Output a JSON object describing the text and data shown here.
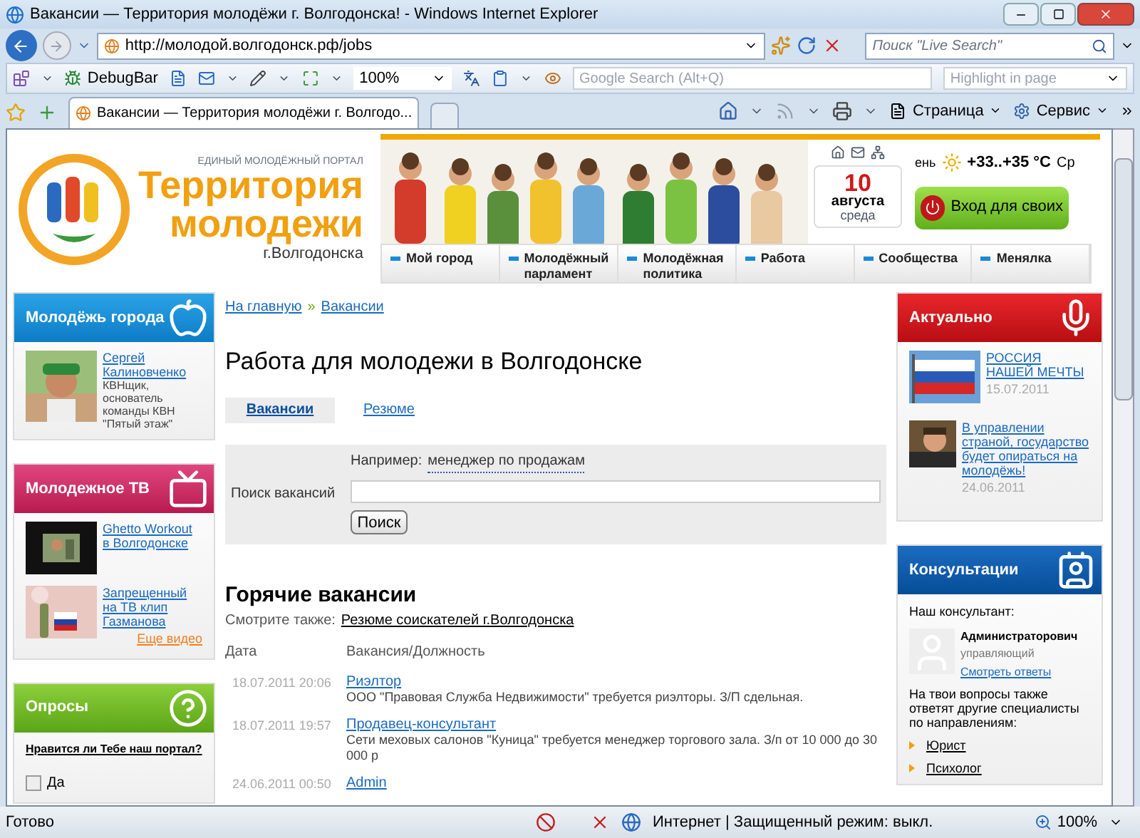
{
  "window": {
    "title": "Вакансии — Территория молодёжи г. Волгодонска! - Windows Internet Explorer"
  },
  "address_bar": {
    "url": "http://молодой.волгодонск.рф/jobs",
    "search_placeholder": "Поиск \"Live Search\""
  },
  "toolbar": {
    "debugbar": "DebugBar",
    "zoom": "100%",
    "google_placeholder": "Google Search (Alt+Q)",
    "highlight_placeholder": "Highlight in page"
  },
  "tabs": [
    {
      "label": "Вакансии — Территория молодёжи г. Волгодо...",
      "selected": true
    }
  ],
  "command_bar": [
    "Страница",
    "Сервис"
  ],
  "header": {
    "tagline": "ЕДИНЫЙ МОЛОДЁЖНЫЙ ПОРТАЛ",
    "title_1": "Территория",
    "title_2": "молодежи",
    "city": "г.Волгодонска",
    "date": {
      "day": "10",
      "month": "августа",
      "weekday": "среда"
    },
    "weather": {
      "prefix": "ень",
      "temperature": "+33..+35 °C",
      "suffix": "Ср"
    },
    "login": "Вход для своих",
    "nav": [
      "Мой город",
      "Молодёжный парламент",
      "Молодёжная политика",
      "Работа",
      "Сообщества",
      "Менялка"
    ]
  },
  "left": {
    "youth": {
      "title": "Молодёжь города",
      "name": "Сергей Калиновченко",
      "desc": "КВНщик, основатель команды КВН \"Пятый этаж\""
    },
    "tv": {
      "title": "Молодежное ТВ",
      "videos": [
        "Ghetto Workout в Волгодонске",
        "Запрещенный на ТВ клип Газманова"
      ],
      "more": "Еще видео"
    },
    "polls": {
      "title": "Опросы",
      "question": "Нравится ли Тебе наш портал?",
      "options": [
        {
          "label": "Да",
          "checked": false
        }
      ]
    }
  },
  "main": {
    "breadcrumbs": [
      "На главную",
      "Вакансии"
    ],
    "separator": "»",
    "heading": "Работа для молодежи в Волгодонске",
    "tabs": [
      {
        "label": "Вакансии",
        "selected": true
      },
      {
        "label": "Резюме",
        "selected": false
      }
    ],
    "search": {
      "example_label": "Например:",
      "example": "менеджер по продажам",
      "label": "Поиск вакансий",
      "button": "Поиск"
    },
    "hot": {
      "title": "Горячие вакансии",
      "see_also_label": "Смотрите также:",
      "see_also_link": "Резюме соискателей г.Волгодонска",
      "columns": [
        "Дата",
        "Вакансия/Должность"
      ],
      "rows": [
        {
          "date": "18.07.2011 20:06",
          "title": "Риэлтор",
          "desc": "ООО \"Правовая Служба Недвижимости\" требуется риэлторы. З/П сдельная."
        },
        {
          "date": "18.07.2011 19:57",
          "title": "Продавец-консультант",
          "desc": "Сети меховых салонов \"Куница\" требуется менеджер торгового зала. З/п от 10 000 до 30 000 р"
        },
        {
          "date": "24.06.2011 00:50",
          "title": "Admin"
        }
      ]
    }
  },
  "right": {
    "actual": {
      "title": "Актуально",
      "items": [
        {
          "title": "РОССИЯ НАШЕЙ МЕЧТЫ",
          "date": "15.07.2011"
        },
        {
          "title": "В управлении страной, государство будет опираться на молодёжь!",
          "date": "24.06.2011"
        }
      ]
    },
    "consult": {
      "title": "Консультации",
      "label": "Наш консультант:",
      "name": "Администраторович",
      "role": "управляющий",
      "link": "Смотреть ответы",
      "note": "На твои вопросы также ответят другие специалисты по направлениям:",
      "specialists": [
        "Юрист",
        "Психолог"
      ]
    }
  },
  "status_bar": {
    "text": "Готово",
    "zone": "Интернет | Защищенный режим: выкл.",
    "zoom": "100%"
  }
}
